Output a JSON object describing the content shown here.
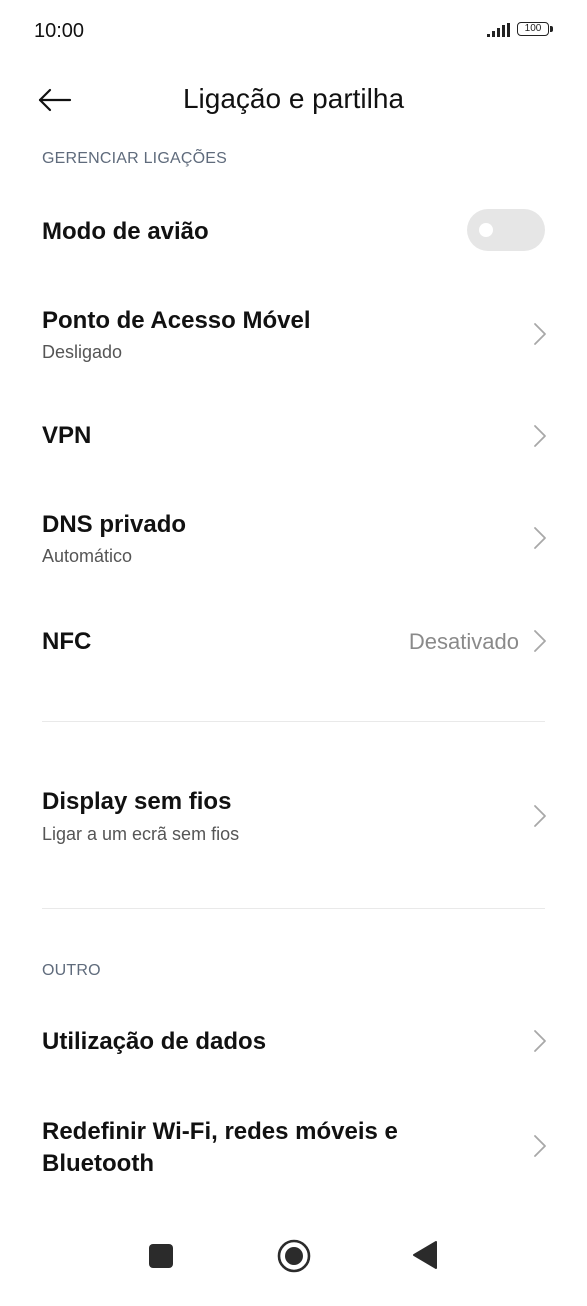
{
  "status_bar": {
    "time": "10:00",
    "battery_level": "100",
    "icons": [
      "signal-icon",
      "battery-icon"
    ]
  },
  "header": {
    "title": "Ligação e partilha",
    "back_icon": "back-arrow-icon"
  },
  "sections": {
    "manage": {
      "header": "GERENCIAR LIGAÇÕES",
      "items": {
        "airplane": {
          "title": "Modo de avião",
          "toggle_on": false
        },
        "hotspot": {
          "title": "Ponto de Acesso Móvel",
          "subtitle": "Desligado"
        },
        "vpn": {
          "title": "VPN"
        },
        "dns": {
          "title": "DNS privado",
          "subtitle": "Automático"
        },
        "nfc": {
          "title": "NFC",
          "value": "Desativado"
        }
      }
    },
    "display": {
      "items": {
        "wireless_display": {
          "title": "Display sem fios",
          "subtitle": "Ligar a um ecrã sem fios"
        }
      }
    },
    "other": {
      "header": "OUTRO",
      "items": {
        "data_usage": {
          "title": "Utilização de dados"
        },
        "reset_network": {
          "title_line1": "Redefinir Wi-Fi, redes móveis e",
          "title_line2": "Bluetooth"
        }
      }
    }
  },
  "nav_bar": {
    "icons": [
      "recents-square-icon",
      "home-circle-icon",
      "back-triangle-icon"
    ]
  },
  "colors": {
    "toggle_off": "#e6e6e6",
    "section_header": "#5f6b7c",
    "chevron": "#a8a8a8",
    "nav_icon": "#2b2b2b"
  }
}
